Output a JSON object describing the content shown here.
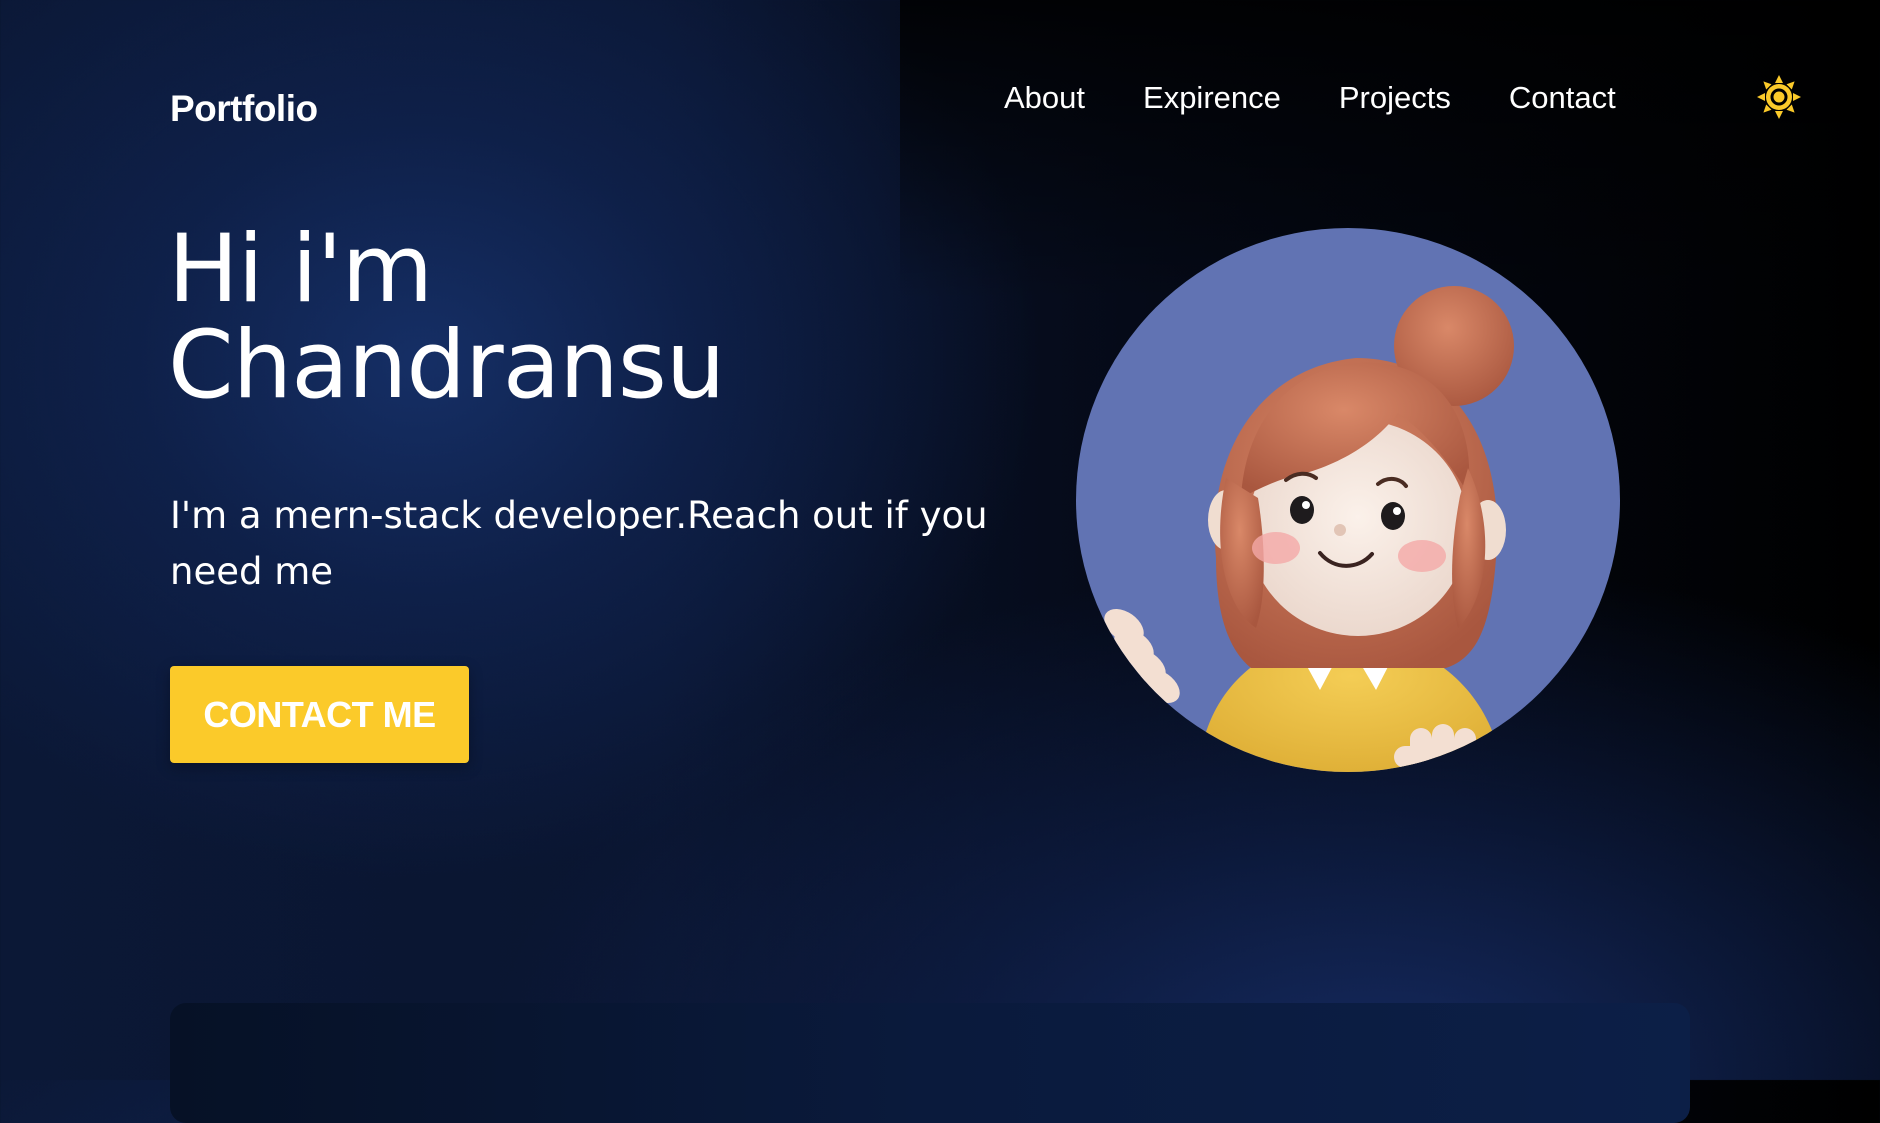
{
  "header": {
    "logo": "Portfolio",
    "nav": [
      {
        "label": "About"
      },
      {
        "label": "Expirence"
      },
      {
        "label": "Projects"
      },
      {
        "label": "Contact"
      }
    ],
    "theme_toggle_icon": "sun-icon",
    "theme_icon_color": "#fbca2a"
  },
  "hero": {
    "greeting": "Hi i'm",
    "name": "Chandransu",
    "tagline": "I'm a mern-stack developer.Reach out if you need me",
    "cta_label": "CONTACT ME",
    "cta_color": "#fbca2a",
    "avatar_icon": "cartoon-girl-avatar",
    "avatar_bg": "#6173b3"
  }
}
